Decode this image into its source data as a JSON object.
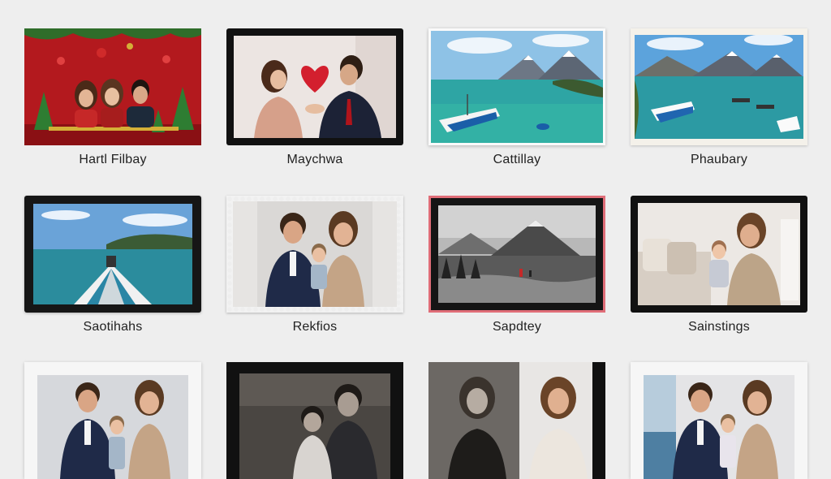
{
  "gallery": {
    "items": [
      {
        "label": "Hartl Filbay",
        "frame": "full",
        "scene": "christmas-family"
      },
      {
        "label": "Maychwa",
        "frame": "black",
        "scene": "couple-heart"
      },
      {
        "label": "Cattillay",
        "frame": "white",
        "scene": "mountain-lake-boats"
      },
      {
        "label": "Phaubary",
        "frame": "torn",
        "scene": "mountain-lake-boats-2"
      },
      {
        "label": "Saotihahs",
        "frame": "black",
        "scene": "boat-bow-sea"
      },
      {
        "label": "Rekfios",
        "frame": "stamp",
        "scene": "family-portrait"
      },
      {
        "label": "Sapdtey",
        "frame": "red-black",
        "scene": "bw-mountains"
      },
      {
        "label": "Sainstings",
        "frame": "black",
        "scene": "mother-child-sofa"
      },
      {
        "label": "",
        "frame": "paper",
        "scene": "family-portrait-2"
      },
      {
        "label": "",
        "frame": "black-crop",
        "scene": "bw-father-son"
      },
      {
        "label": "",
        "frame": "black-crop",
        "scene": "women-split"
      },
      {
        "label": "",
        "frame": "paper",
        "scene": "family-beach"
      }
    ]
  },
  "colors": {
    "background": "#eeeeee",
    "label": "#222222"
  }
}
